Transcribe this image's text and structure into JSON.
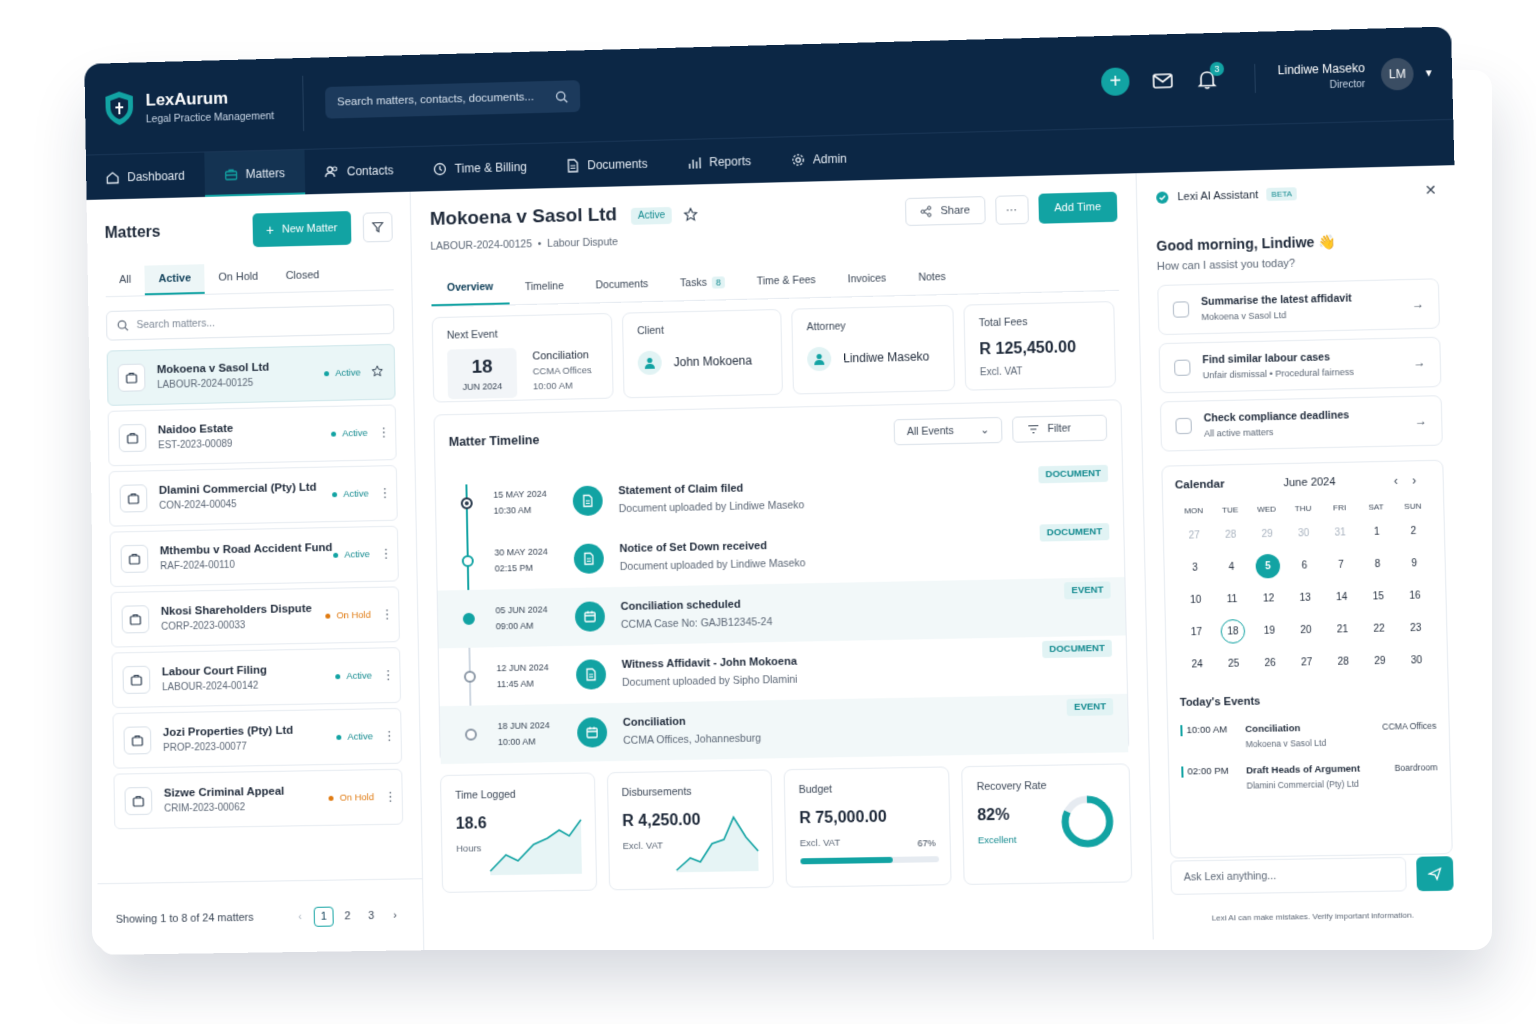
{
  "brand": {
    "name": "LexAurum",
    "tagline": "Legal Practice Management"
  },
  "search": {
    "placeholder": "Search matters, contacts, documents..."
  },
  "header": {
    "notifications": "3",
    "user_name": "Lindiwe Maseko",
    "user_role": "Director",
    "initials": "LM"
  },
  "nav": [
    "Dashboard",
    "Matters",
    "Contacts",
    "Time & Billing",
    "Documents",
    "Reports",
    "Admin"
  ],
  "left": {
    "title": "Matters",
    "new_button": "New Matter",
    "tabs": [
      "All",
      "Active",
      "On Hold",
      "Closed"
    ],
    "search_placeholder": "Search matters...",
    "items": [
      {
        "title": "Mokoena v Sasol Ltd",
        "code": "LABOUR-2024-00125",
        "status": "Active"
      },
      {
        "title": "Naidoo Estate",
        "code": "EST-2023-00089",
        "status": "Active"
      },
      {
        "title": "Dlamini Commercial (Pty) Ltd",
        "code": "CON-2024-00045",
        "status": "Active"
      },
      {
        "title": "Mthembu v Road Accident Fund",
        "code": "RAF-2024-00110",
        "status": "Active"
      },
      {
        "title": "Nkosi Shareholders Dispute",
        "code": "CORP-2023-00033",
        "status": "On Hold"
      },
      {
        "title": "Labour Court Filing",
        "code": "LABOUR-2024-00142",
        "status": "Active"
      },
      {
        "title": "Jozi Properties (Pty) Ltd",
        "code": "PROP-2023-00077",
        "status": "Active"
      },
      {
        "title": "Sizwe Criminal Appeal",
        "code": "CRIM-2023-00062",
        "status": "On Hold"
      }
    ],
    "showing": "Showing 1 to 8 of 24 matters",
    "pages": [
      "1",
      "2",
      "3"
    ]
  },
  "matter": {
    "title": "Mokoena v Sasol Ltd",
    "status": "Active",
    "code": "LABOUR-2024-00125",
    "type": "Labour Dispute",
    "share": "Share",
    "add_time": "Add Time",
    "tabs": [
      {
        "label": "Overview"
      },
      {
        "label": "Timeline"
      },
      {
        "label": "Documents"
      },
      {
        "label": "Tasks",
        "count": "8"
      },
      {
        "label": "Time & Fees"
      },
      {
        "label": "Invoices"
      },
      {
        "label": "Notes"
      }
    ],
    "next_event": {
      "label": "Next Event",
      "day": "18",
      "month": "JUN 2024",
      "title": "Conciliation",
      "place": "CCMA Offices",
      "time": "10:00 AM"
    },
    "client": {
      "label": "Client",
      "name": "John Mokoena"
    },
    "attorney": {
      "label": "Attorney",
      "name": "Lindiwe Maseko"
    },
    "fees": {
      "label": "Total Fees",
      "value": "R 125,450.00",
      "note": "Excl. VAT"
    }
  },
  "timeline": {
    "title": "Matter Timeline",
    "select": "All Events",
    "filter": "Filter",
    "events": [
      {
        "date": "15 MAY 2024",
        "time": "10:30 AM",
        "title": "Statement of Claim filed",
        "sub": "Document uploaded by Lindiwe Maseko",
        "tag": "DOCUMENT"
      },
      {
        "date": "30 MAY 2024",
        "time": "02:15 PM",
        "title": "Notice of Set Down received",
        "sub": "Document uploaded by Lindiwe Maseko",
        "tag": "DOCUMENT"
      },
      {
        "date": "05 JUN 2024",
        "time": "09:00 AM",
        "title": "Conciliation scheduled",
        "sub": "CCMA Case No: GAJB12345-24",
        "tag": "EVENT"
      },
      {
        "date": "12 JUN 2024",
        "time": "11:45 AM",
        "title": "Witness Affidavit - John Mokoena",
        "sub": "Document uploaded by Sipho Dlamini",
        "tag": "DOCUMENT"
      },
      {
        "date": "18 JUN 2024",
        "time": "10:00 AM",
        "title": "Conciliation",
        "sub": "CCMA Offices, Johannesburg",
        "tag": "EVENT"
      }
    ]
  },
  "stats": {
    "time": {
      "label": "Time Logged",
      "value": "18.6",
      "unit": "Hours"
    },
    "disb": {
      "label": "Disbursements",
      "value": "R 4,250.00",
      "unit": "Excl. VAT"
    },
    "budget": {
      "label": "Budget",
      "value": "R 75,000.00",
      "unit": "Excl. VAT",
      "pct": "67%",
      "fraction": 0.67
    },
    "recovery": {
      "label": "Recovery Rate",
      "value": "82%",
      "note": "Excellent",
      "fraction": 0.82
    }
  },
  "assistant": {
    "title": "Lexi AI Assistant",
    "beta": "BETA",
    "greeting": "Good morning, Lindiwe 👋",
    "prompt": "How can I assist you today?",
    "suggestions": [
      {
        "title": "Summarise the latest affidavit",
        "sub": "Mokoena v Sasol Ltd"
      },
      {
        "title": "Find similar labour cases",
        "sub": "Unfair dismissal • Procedural fairness"
      },
      {
        "title": "Check compliance deadlines",
        "sub": "All active matters"
      }
    ],
    "ask_placeholder": "Ask Lexi anything...",
    "disclaimer": "Lexi AI can make mistakes. Verify important information."
  },
  "calendar": {
    "title": "Calendar",
    "month": "June 2024",
    "weekdays": [
      "MON",
      "TUE",
      "WED",
      "THU",
      "FRI",
      "SAT",
      "SUN"
    ],
    "days": [
      "27",
      "28",
      "29",
      "30",
      "31",
      "1",
      "2",
      "3",
      "4",
      "5",
      "6",
      "7",
      "8",
      "9",
      "10",
      "11",
      "12",
      "13",
      "14",
      "15",
      "16",
      "17",
      "18",
      "19",
      "20",
      "21",
      "22",
      "23",
      "24",
      "25",
      "26",
      "27",
      "28",
      "29",
      "30"
    ],
    "selected": "5",
    "today": "18"
  },
  "today_events": {
    "title": "Today's Events",
    "items": [
      {
        "time": "10:00 AM",
        "title": "Conciliation",
        "sub": "Mokoena v Sasol Ltd",
        "loc": "CCMA Offices"
      },
      {
        "time": "02:00 PM",
        "title": "Draft Heads of Argument",
        "sub": "Dlamini Commercial (Pty) Ltd",
        "loc": "Boardroom"
      }
    ]
  },
  "colors": {
    "navy": "#0c2745",
    "teal": "#12a3a3",
    "active": "#12a3a3",
    "on_hold": "#e07b12"
  }
}
